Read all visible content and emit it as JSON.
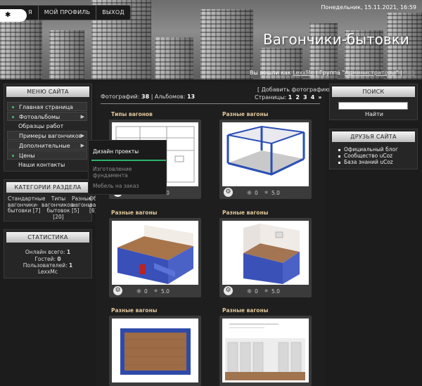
{
  "header": {
    "nav": [
      "Я",
      "МОЙ ПРОФИЛЬ",
      "ВЫХОД"
    ],
    "date": "Понедельник, 15.11.2021, 16:59",
    "site_title": "Вагончики-бытовки",
    "login_prefix": "Вы вошли как",
    "login_user": "LexxMc",
    "login_group_label": "| Группа \"",
    "login_group": "Администраторы",
    "login_group_suffix": "\" |",
    "rss": "RSS"
  },
  "site_menu": {
    "title": "МЕНЮ САЙТА",
    "items": [
      {
        "label": "Главная страница",
        "bullet": true,
        "submenu": false
      },
      {
        "label": "Фотоальбомы",
        "bullet": true,
        "submenu": true
      },
      {
        "label": "Образцы работ",
        "bullet": false,
        "submenu": false
      },
      {
        "label": "Примеры вагончиков по",
        "bullet": false,
        "submenu": true
      },
      {
        "label": "Дополнительные услуги",
        "bullet": false,
        "submenu": true
      },
      {
        "label": "Цены",
        "bullet": true,
        "submenu": false
      },
      {
        "label": "Наши контакты",
        "bullet": false,
        "submenu": false
      }
    ]
  },
  "dropdown": {
    "items": [
      "Дизайн проекты",
      "Изготовление фундамента",
      "Мебель на заказ"
    ]
  },
  "categories": {
    "title": "КАТЕГОРИИ РАЗДЕЛА",
    "cells": [
      {
        "line1": "Стандартные",
        "line2": "вагончики-",
        "line3": "бытовки [7]"
      },
      {
        "line1": "Типы",
        "line2": "вагончиков-",
        "line3": "бытовок",
        "line4": "[20]"
      },
      {
        "line1": "Разные",
        "line2": "вагоны",
        "line3": "[5]"
      },
      {
        "line1": "Образцы",
        "line2": "работ",
        "line3": "[6]"
      }
    ]
  },
  "stats": {
    "title": "СТАТИСТИКА",
    "online_label": "Онлайн всего:",
    "online": "1",
    "guests_label": "Гостей:",
    "guests": "0",
    "users_label": "Пользователей:",
    "users": "1",
    "user_name": "LexxMc"
  },
  "gallery": {
    "photos_label": "Фотографий:",
    "photos": "38",
    "albums_label": "| Альбомов:",
    "albums": "13",
    "add_photo": "[ Добавить фотографию ]",
    "pages_label": "Страницы:",
    "pages": [
      "1",
      "2",
      "3",
      "4",
      "»"
    ],
    "cards": [
      {
        "title": "Типы вагонов",
        "views": "0",
        "rating": "5.0"
      },
      {
        "title": "Разные вагоны",
        "views": "0",
        "rating": "5.0"
      },
      {
        "title": "Разные вагоны",
        "views": "0",
        "rating": "5.0"
      },
      {
        "title": "Разные вагоны",
        "views": "0",
        "rating": "5.0"
      },
      {
        "title": "Разные вагоны",
        "views": "",
        "rating": ""
      },
      {
        "title": "Разные вагоны",
        "views": "",
        "rating": ""
      }
    ]
  },
  "search": {
    "title": "ПОИСК",
    "button": "Найти"
  },
  "friends": {
    "title": "ДРУЗЬЯ САЙТА",
    "items": [
      "Официальный блог",
      "Сообщество uCoz",
      "База знаний uCoz"
    ]
  },
  "colors": {
    "accent_green": "#2eb36b",
    "title_gold": "#e2c79a"
  }
}
